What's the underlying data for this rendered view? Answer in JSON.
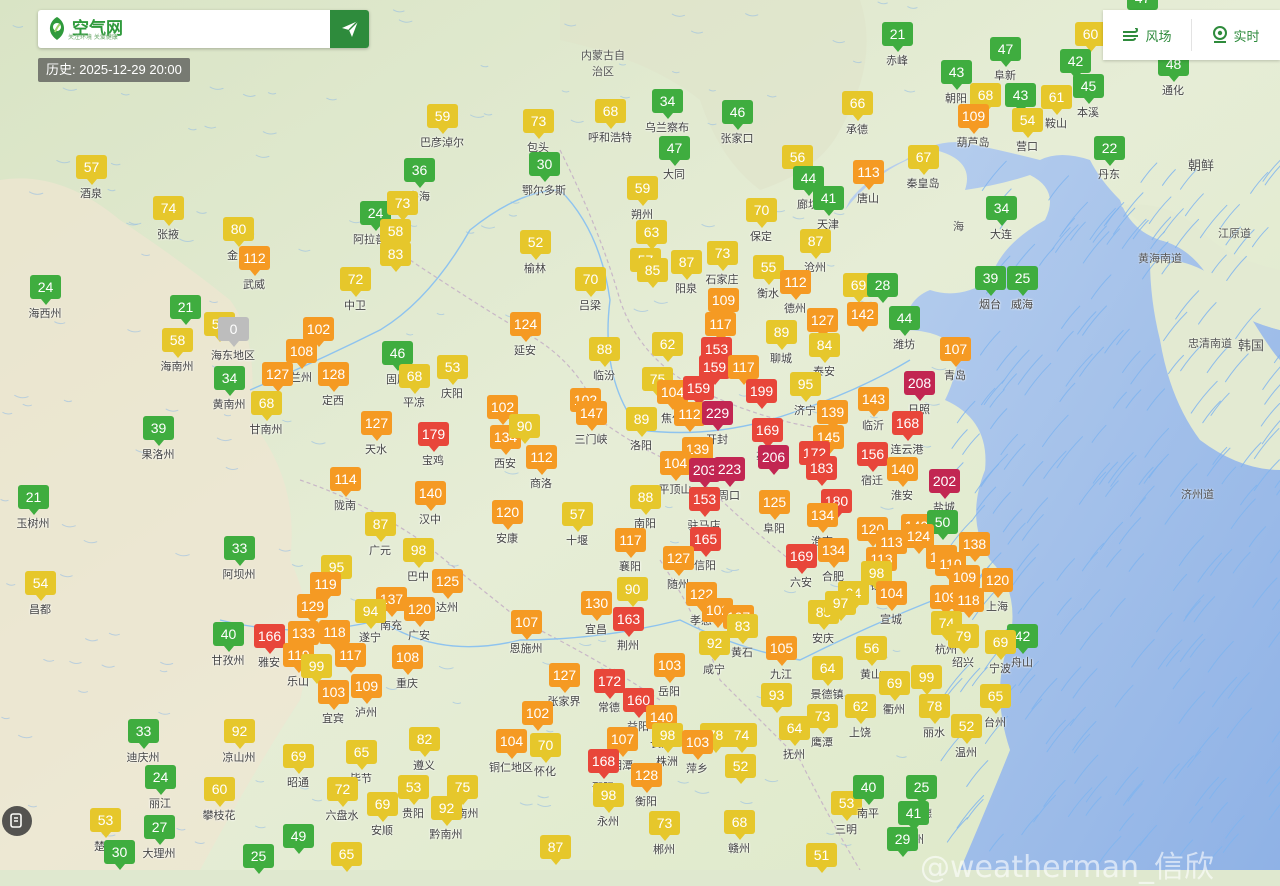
{
  "search": {
    "placeholder": "",
    "logo_text": "空气网",
    "logo_sub": "关注环境 关爱健康"
  },
  "history_label": "历史: 2025-12-29 20:00",
  "modes": [
    {
      "label": "风场",
      "icon": "wind-icon"
    },
    {
      "label": "实时",
      "icon": "location-icon"
    }
  ],
  "watermark": "@weatherman_信欣",
  "colors": {
    "good": "#3fad3f",
    "moderate": "#e6c72b",
    "sensitive": "#f59a23",
    "unhealthy": "#e8463a",
    "very_unhealthy": "#c22652",
    "no_data": "#bdbdbd",
    "brand": "#2e8b3c"
  },
  "regions": [
    "内蒙古自治区",
    "朝鲜",
    "韩国",
    "海",
    "黄海南道",
    "江原道",
    "忠清南道",
    "济州道"
  ],
  "stations": [
    {
      "v": "21",
      "n": "赤峰"
    },
    {
      "v": "47",
      "n": "阜新"
    },
    {
      "v": "60",
      "n": ""
    },
    {
      "v": "42",
      "n": ""
    },
    {
      "v": "47",
      "n": ""
    },
    {
      "v": "48",
      "n": "通化"
    },
    {
      "v": "43",
      "n": "朝阳"
    },
    {
      "v": "68",
      "n": ""
    },
    {
      "v": "43",
      "n": ""
    },
    {
      "v": "61",
      "n": "鞍山"
    },
    {
      "v": "45",
      "n": "本溪"
    },
    {
      "v": "109",
      "n": "葫芦岛"
    },
    {
      "v": "54",
      "n": "营口"
    },
    {
      "v": "22",
      "n": "丹东"
    },
    {
      "v": "59",
      "n": "巴彦淖尔"
    },
    {
      "v": "73",
      "n": "包头"
    },
    {
      "v": "68",
      "n": "呼和浩特"
    },
    {
      "v": "34",
      "n": "乌兰察布"
    },
    {
      "v": "46",
      "n": "张家口"
    },
    {
      "v": "66",
      "n": "承德"
    },
    {
      "v": "57",
      "n": "酒泉"
    },
    {
      "v": "36",
      "n": "乌海"
    },
    {
      "v": "30",
      "n": "鄂尔多斯"
    },
    {
      "v": "47",
      "n": "大同"
    },
    {
      "v": "56",
      "n": ""
    },
    {
      "v": "44",
      "n": "廊坊"
    },
    {
      "v": "113",
      "n": "唐山"
    },
    {
      "v": "67",
      "n": "秦皇岛"
    },
    {
      "v": "74",
      "n": "张掖"
    },
    {
      "v": "24",
      "n": "阿拉善盟"
    },
    {
      "v": "73",
      "n": ""
    },
    {
      "v": "41",
      "n": "天津"
    },
    {
      "v": "34",
      "n": "大连"
    },
    {
      "v": "80",
      "n": "金昌"
    },
    {
      "v": "58",
      "n": ""
    },
    {
      "v": "59",
      "n": "朔州"
    },
    {
      "v": "70",
      "n": "保定"
    },
    {
      "v": "52",
      "n": "榆林"
    },
    {
      "v": "63",
      "n": ""
    },
    {
      "v": "87",
      "n": "沧州"
    },
    {
      "v": "112",
      "n": "武威"
    },
    {
      "v": "83",
      "n": ""
    },
    {
      "v": "57",
      "n": ""
    },
    {
      "v": "85",
      "n": ""
    },
    {
      "v": "87",
      "n": "阳泉"
    },
    {
      "v": "73",
      "n": "石家庄"
    },
    {
      "v": "55",
      "n": "衡水"
    },
    {
      "v": "24",
      "n": "海西州"
    },
    {
      "v": "72",
      "n": "中卫"
    },
    {
      "v": "70",
      "n": "吕梁"
    },
    {
      "v": "112",
      "n": "德州"
    },
    {
      "v": "69",
      "n": ""
    },
    {
      "v": "28",
      "n": ""
    },
    {
      "v": "39",
      "n": "烟台"
    },
    {
      "v": "25",
      "n": "威海"
    },
    {
      "v": "21",
      "n": ""
    },
    {
      "v": "57",
      "n": ""
    },
    {
      "v": "0",
      "n": "海东地区"
    },
    {
      "v": "102",
      "n": ""
    },
    {
      "v": "109",
      "n": "晋中"
    },
    {
      "v": "117",
      "n": ""
    },
    {
      "v": "127",
      "n": "淄博"
    },
    {
      "v": "142",
      "n": ""
    },
    {
      "v": "44",
      "n": "潍坊"
    },
    {
      "v": "58",
      "n": "海南州"
    },
    {
      "v": "108",
      "n": "兰州"
    },
    {
      "v": "124",
      "n": "延安"
    },
    {
      "v": "62",
      "n": ""
    },
    {
      "v": "89",
      "n": "聊城"
    },
    {
      "v": "84",
      "n": "泰安"
    },
    {
      "v": "107",
      "n": "青岛"
    },
    {
      "v": "153",
      "n": ""
    },
    {
      "v": "34",
      "n": "黄南州"
    },
    {
      "v": "127",
      "n": ""
    },
    {
      "v": "128",
      "n": "定西"
    },
    {
      "v": "46",
      "n": "固原"
    },
    {
      "v": "53",
      "n": "庆阳"
    },
    {
      "v": "88",
      "n": "临汾"
    },
    {
      "v": "159",
      "n": ""
    },
    {
      "v": "117",
      "n": ""
    },
    {
      "v": "68",
      "n": "甘南州"
    },
    {
      "v": "68",
      "n": "平凉"
    },
    {
      "v": "75",
      "n": ""
    },
    {
      "v": "104",
      "n": "焦作"
    },
    {
      "v": "159",
      "n": "鹤壁"
    },
    {
      "v": "199",
      "n": ""
    },
    {
      "v": "95",
      "n": "济宁"
    },
    {
      "v": "208",
      "n": "日照"
    },
    {
      "v": "39",
      "n": "果洛州"
    },
    {
      "v": "102",
      "n": ""
    },
    {
      "v": "102",
      "n": ""
    },
    {
      "v": "147",
      "n": "三门峡"
    },
    {
      "v": "89",
      "n": "洛阳"
    },
    {
      "v": "112",
      "n": ""
    },
    {
      "v": "229",
      "n": "开封"
    },
    {
      "v": "139",
      "n": "枣庄"
    },
    {
      "v": "143",
      "n": "临沂"
    },
    {
      "v": "127",
      "n": "天水"
    },
    {
      "v": "179",
      "n": "宝鸡"
    },
    {
      "v": "134",
      "n": "西安"
    },
    {
      "v": "90",
      "n": ""
    },
    {
      "v": "169",
      "n": "亳州"
    },
    {
      "v": "145",
      "n": ""
    },
    {
      "v": "168",
      "n": "连云港"
    },
    {
      "v": "139",
      "n": ""
    },
    {
      "v": "112",
      "n": "商洛"
    },
    {
      "v": "104",
      "n": "平顶山"
    },
    {
      "v": "206",
      "n": ""
    },
    {
      "v": "172",
      "n": ""
    },
    {
      "v": "156",
      "n": "宿迁"
    },
    {
      "v": "203",
      "n": ""
    },
    {
      "v": "223",
      "n": "周口"
    },
    {
      "v": "183",
      "n": ""
    },
    {
      "v": "140",
      "n": "淮安"
    },
    {
      "v": "202",
      "n": "盐城"
    },
    {
      "v": "21",
      "n": "玉树州"
    },
    {
      "v": "114",
      "n": "陇南"
    },
    {
      "v": "140",
      "n": "汉中"
    },
    {
      "v": "88",
      "n": "南阳"
    },
    {
      "v": "153",
      "n": "驻马店"
    },
    {
      "v": "125",
      "n": "阜阳"
    },
    {
      "v": "180",
      "n": ""
    },
    {
      "v": "120",
      "n": "安康"
    },
    {
      "v": "57",
      "n": "十堰"
    },
    {
      "v": "134",
      "n": "淮南"
    },
    {
      "v": "87",
      "n": "广元"
    },
    {
      "v": "117",
      "n": "襄阳"
    },
    {
      "v": "165",
      "n": "信阳"
    },
    {
      "v": "120",
      "n": ""
    },
    {
      "v": "140",
      "n": ""
    },
    {
      "v": "50",
      "n": ""
    },
    {
      "v": "124",
      "n": ""
    },
    {
      "v": "33",
      "n": "阿坝州"
    },
    {
      "v": "98",
      "n": "巴中"
    },
    {
      "v": "113",
      "n": ""
    },
    {
      "v": "138",
      "n": ""
    },
    {
      "v": "95",
      "n": ""
    },
    {
      "v": "127",
      "n": "随州"
    },
    {
      "v": "169",
      "n": "六安"
    },
    {
      "v": "134",
      "n": "合肥"
    },
    {
      "v": "113",
      "n": "镇江"
    },
    {
      "v": "132",
      "n": ""
    },
    {
      "v": "110",
      "n": ""
    },
    {
      "v": "54",
      "n": "昌都"
    },
    {
      "v": "119",
      "n": ""
    },
    {
      "v": "125",
      "n": "达州"
    },
    {
      "v": "98",
      "n": ""
    },
    {
      "v": "109",
      "n": ""
    },
    {
      "v": "120",
      "n": "上海"
    },
    {
      "v": "129",
      "n": ""
    },
    {
      "v": "137",
      "n": "南充"
    },
    {
      "v": "94",
      "n": "遂宁"
    },
    {
      "v": "120",
      "n": "广安"
    },
    {
      "v": "130",
      "n": "宜昌"
    },
    {
      "v": "90",
      "n": ""
    },
    {
      "v": "122",
      "n": "孝感"
    },
    {
      "v": "94",
      "n": ""
    },
    {
      "v": "104",
      "n": "宣城"
    },
    {
      "v": "109",
      "n": ""
    },
    {
      "v": "118",
      "n": ""
    },
    {
      "v": "102",
      "n": ""
    },
    {
      "v": "107",
      "n": ""
    },
    {
      "v": "85",
      "n": "安庆"
    },
    {
      "v": "97",
      "n": ""
    },
    {
      "v": "40",
      "n": "甘孜州"
    },
    {
      "v": "166",
      "n": "雅安"
    },
    {
      "v": "133",
      "n": ""
    },
    {
      "v": "118",
      "n": ""
    },
    {
      "v": "107",
      "n": "恩施州"
    },
    {
      "v": "163",
      "n": "荆州"
    },
    {
      "v": "83",
      "n": "黄石"
    },
    {
      "v": "74",
      "n": "杭州"
    },
    {
      "v": "79",
      "n": "绍兴"
    },
    {
      "v": "42",
      "n": "舟山"
    },
    {
      "v": "69",
      "n": "宁波"
    },
    {
      "v": "119",
      "n": "乐山"
    },
    {
      "v": "117",
      "n": ""
    },
    {
      "v": "108",
      "n": "重庆"
    },
    {
      "v": "92",
      "n": "咸宁"
    },
    {
      "v": "105",
      "n": "九江"
    },
    {
      "v": "56",
      "n": "黄山"
    },
    {
      "v": "99",
      "n": ""
    },
    {
      "v": "103",
      "n": "岳阳"
    },
    {
      "v": "64",
      "n": "景德镇"
    },
    {
      "v": "103",
      "n": "宜宾"
    },
    {
      "v": "109",
      "n": "泸州"
    },
    {
      "v": "127",
      "n": "张家界"
    },
    {
      "v": "172",
      "n": "常德"
    },
    {
      "v": "69",
      "n": "衢州"
    },
    {
      "v": "99",
      "n": ""
    },
    {
      "v": "160",
      "n": "益阳"
    },
    {
      "v": "93",
      "n": ""
    },
    {
      "v": "33",
      "n": "迪庆州"
    },
    {
      "v": "92",
      "n": "凉山州"
    },
    {
      "v": "82",
      "n": "遵义"
    },
    {
      "v": "102",
      "n": ""
    },
    {
      "v": "140",
      "n": "长沙"
    },
    {
      "v": "78",
      "n": "丽水"
    },
    {
      "v": "65",
      "n": "台州"
    },
    {
      "v": "73",
      "n": "鹰潭"
    },
    {
      "v": "62",
      "n": "上饶"
    },
    {
      "v": "98",
      "n": "株洲"
    },
    {
      "v": "78",
      "n": ""
    },
    {
      "v": "74",
      "n": "吉安"
    },
    {
      "v": "64",
      "n": "抚州"
    },
    {
      "v": "52",
      "n": "温州"
    },
    {
      "v": "104",
      "n": "铜仁地区"
    },
    {
      "v": "70",
      "n": "怀化"
    },
    {
      "v": "107",
      "n": "湘潭"
    },
    {
      "v": "103",
      "n": "萍乡"
    },
    {
      "v": "69",
      "n": "昭通"
    },
    {
      "v": "65",
      "n": "毕节"
    },
    {
      "v": "168",
      "n": "邵阳"
    },
    {
      "v": "52",
      "n": ""
    },
    {
      "v": "24",
      "n": "丽江"
    },
    {
      "v": "60",
      "n": "攀枝花"
    },
    {
      "v": "72",
      "n": "六盘水"
    },
    {
      "v": "53",
      "n": "贵阳"
    },
    {
      "v": "75",
      "n": "黔南州"
    },
    {
      "v": "128",
      "n": "衡阳"
    },
    {
      "v": "69",
      "n": "安顺"
    },
    {
      "v": "92",
      "n": "黔南州"
    },
    {
      "v": "98",
      "n": "永州"
    },
    {
      "v": "53",
      "n": "三明"
    },
    {
      "v": "40",
      "n": "南平"
    },
    {
      "v": "25",
      "n": "宁德"
    },
    {
      "v": "41",
      "n": "福州"
    },
    {
      "v": "53",
      "n": "楚雄"
    },
    {
      "v": "27",
      "n": "大理州"
    },
    {
      "v": "73",
      "n": "郴州"
    },
    {
      "v": "68",
      "n": "赣州"
    },
    {
      "v": "29",
      "n": ""
    },
    {
      "v": "30",
      "n": ""
    },
    {
      "v": "25",
      "n": ""
    },
    {
      "v": "49",
      "n": ""
    },
    {
      "v": "65",
      "n": ""
    },
    {
      "v": "87",
      "n": ""
    },
    {
      "v": "51",
      "n": ""
    }
  ]
}
